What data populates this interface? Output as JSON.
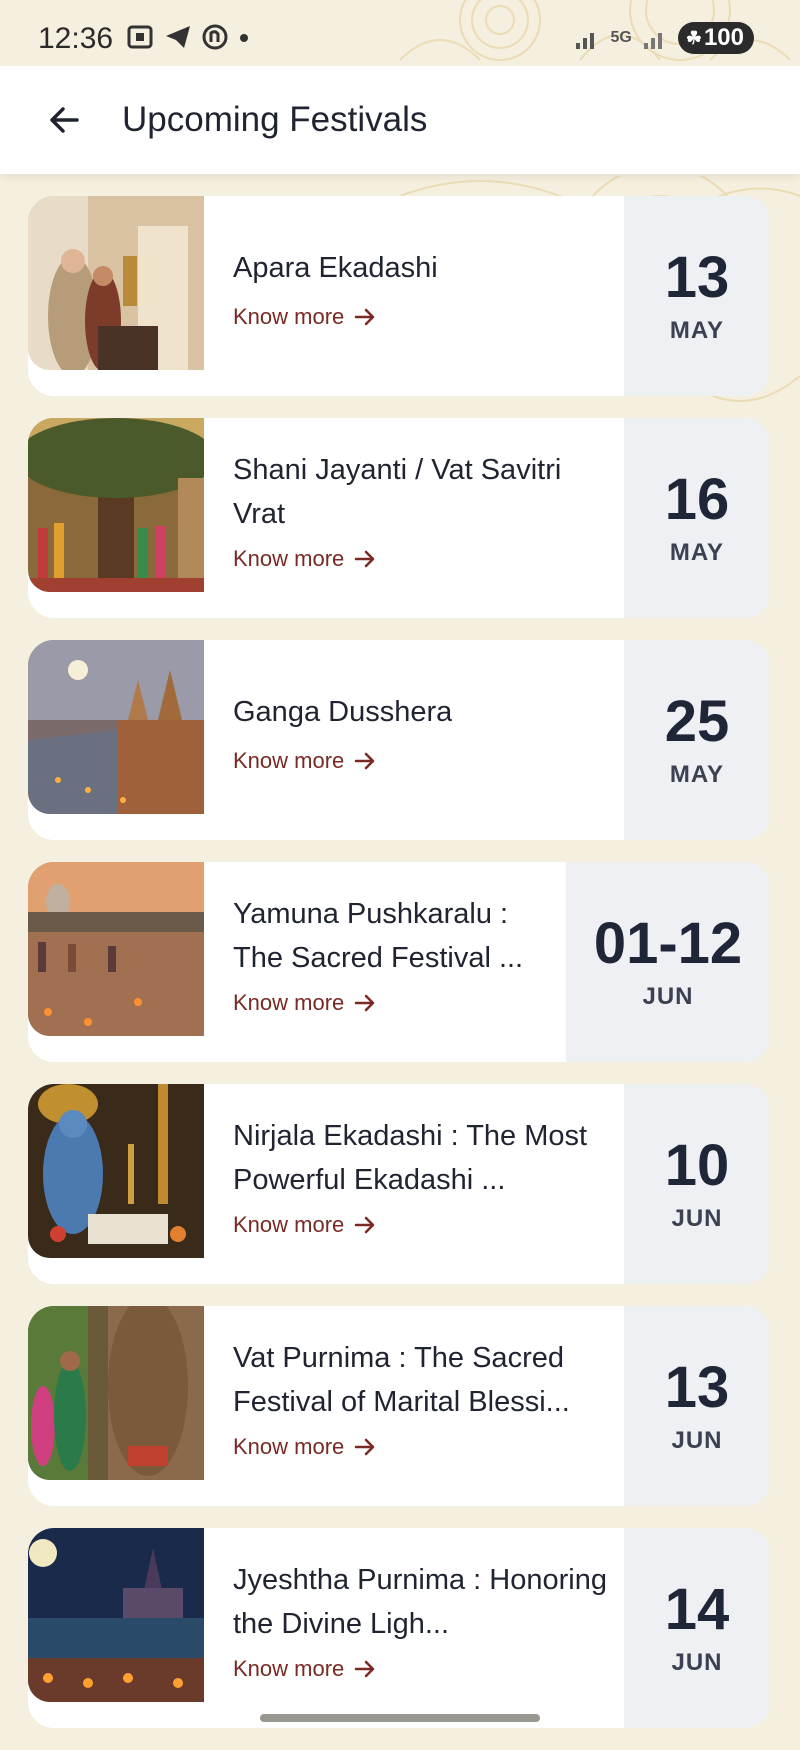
{
  "status": {
    "time": "12:36",
    "battery": "100",
    "network": "5G"
  },
  "header": {
    "title": "Upcoming Festivals"
  },
  "colors": {
    "background": "#f5efdf",
    "accent_link": "#7a2a24",
    "date_text": "#1f2638",
    "date_box": "#eef0f3"
  },
  "festivals": [
    {
      "name": "Apara Ekadashi",
      "link": "Know more",
      "day": "13",
      "month": "MAY"
    },
    {
      "name": "Shani Jayanti / Vat Savitri Vrat",
      "link": "Know more",
      "day": "16",
      "month": "MAY"
    },
    {
      "name": "Ganga Dusshera",
      "link": "Know more",
      "day": "25",
      "month": "MAY"
    },
    {
      "name": "Yamuna Pushkaralu : The Sacred Festival ...",
      "link": "Know more",
      "day": "01-12",
      "month": "JUN"
    },
    {
      "name": "Nirjala Ekadashi : The Most Powerful Ekadashi ...",
      "link": "Know more",
      "day": "10",
      "month": "JUN"
    },
    {
      "name": "Vat Purnima : The Sacred Festival of Marital Blessi...",
      "link": "Know more",
      "day": "13",
      "month": "JUN"
    },
    {
      "name": "Jyeshtha Purnima : Honoring the Divine Ligh...",
      "link": "Know more",
      "day": "14",
      "month": "JUN"
    }
  ]
}
